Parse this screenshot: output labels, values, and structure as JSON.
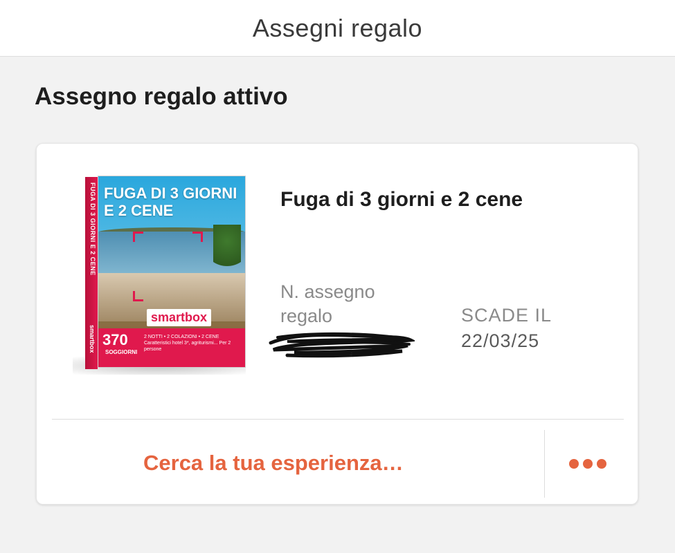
{
  "header": {
    "title": "Assegni regalo"
  },
  "section": {
    "title": "Assegno regalo attivo"
  },
  "voucher_card": {
    "product_image": {
      "box_title": "FUGA DI 3 GIORNI E 2 CENE",
      "spine_text": "FUGA DI 3 GIORNI E 2 CENE",
      "spine_brand": "smartbox",
      "brand": "smartbox",
      "count": "370",
      "count_label": "SOGGIORNI",
      "description": "2 NOTTI • 2 COLAZIONI • 2 CENE Caratteristici hotel 3*, agriturismi... Per 2 persone"
    },
    "experience_title": "Fuga di 3 giorni e 2 cene",
    "voucher_number_label": "N. assegno regalo",
    "expiry_label": "SCADE IL",
    "expiry_date": "22/03/25",
    "search_link": "Cerca la tua esperienza…",
    "more_icon": "more-horizontal-icon"
  },
  "colors": {
    "accent": "#e5643f",
    "brand_pink": "#e0194d",
    "background": "#f2f2f2"
  }
}
